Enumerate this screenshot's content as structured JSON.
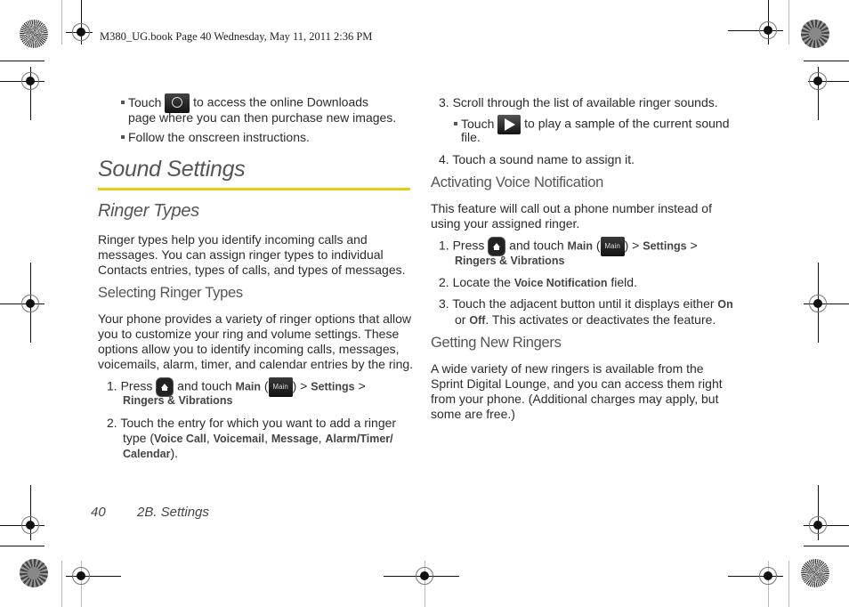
{
  "header": {
    "print_line": "M380_UG.book  Page 40  Wednesday, May 11, 2011  2:36 PM"
  },
  "left_column": {
    "bullets_top": [
      {
        "pre": "Touch",
        "icon": "downloads-icon",
        "post": "to access the online Downloads",
        "cont": "page where you can then purchase new images."
      },
      {
        "text": "Follow the onscreen instructions."
      }
    ],
    "section_title": "Sound Settings",
    "subsection_title": "Ringer Types",
    "intro_lines": [
      "Ringer types help you identify incoming calls and",
      "messages. You can assign ringer types to individual",
      "Contacts entries, types of calls, and types of messages."
    ],
    "selecting_heading": "Selecting Ringer Types",
    "selecting_lines": [
      "Your phone provides a variety of ringer options that allow",
      "you to customize your ring and volume settings. These",
      "options allow you to identify incoming calls, messages,",
      "voicemails, alarm, timer, and calendar entries by the ring."
    ],
    "step1": {
      "num": "1.",
      "press": "Press",
      "and_touch": "and touch",
      "main": "Main",
      "main_icon": "Main",
      "settings": "Settings",
      "ringers": "Ringers & Vibrations",
      "sep": ">"
    },
    "step2": {
      "num": "2.",
      "line1": "Touch the entry for which you want to add a ringer",
      "type": "type (",
      "voice_call": "Voice Call",
      "voicemail": "Voicemail",
      "message": "Message",
      "alarm": "Alarm/Timer/",
      "calendar": "Calendar",
      "end": ")."
    }
  },
  "right_column": {
    "step3": {
      "num": "3.",
      "text": "Scroll through the list of available ringer sounds."
    },
    "step3_bullet": {
      "pre": "Touch",
      "icon": "play-icon",
      "post": "to play a sample of the current sound",
      "cont": "file."
    },
    "step4": {
      "num": "4.",
      "text": "Touch a sound name to assign it."
    },
    "voice_heading": "Activating Voice Notification",
    "voice_lines": [
      "This feature will call out a phone number instead of",
      "using your assigned ringer."
    ],
    "v_step1": {
      "num": "1.",
      "press": "Press",
      "and_touch": "and touch",
      "main": "Main",
      "main_icon": "Main",
      "settings": "Settings",
      "ringers": "Ringers & Vibrations",
      "sep": ">"
    },
    "v_step2": {
      "num": "2.",
      "pre": "Locate the",
      "bold": "Voice Notification",
      "post": "field."
    },
    "v_step3": {
      "num": "3.",
      "line1": "Touch the adjacent button until it displays either",
      "on": "On",
      "or": "or",
      "off": "Off",
      "rest": ". This activates or deactivates the feature."
    },
    "getting_heading": "Getting New Ringers",
    "getting_lines": [
      "A wide variety of new ringers is available from the",
      "Sprint Digital Lounge, and you can access them right",
      "from your phone. (Additional charges may apply, but",
      "some are free.)"
    ]
  },
  "footer": {
    "page_number": "40",
    "section": "2B. Settings"
  }
}
